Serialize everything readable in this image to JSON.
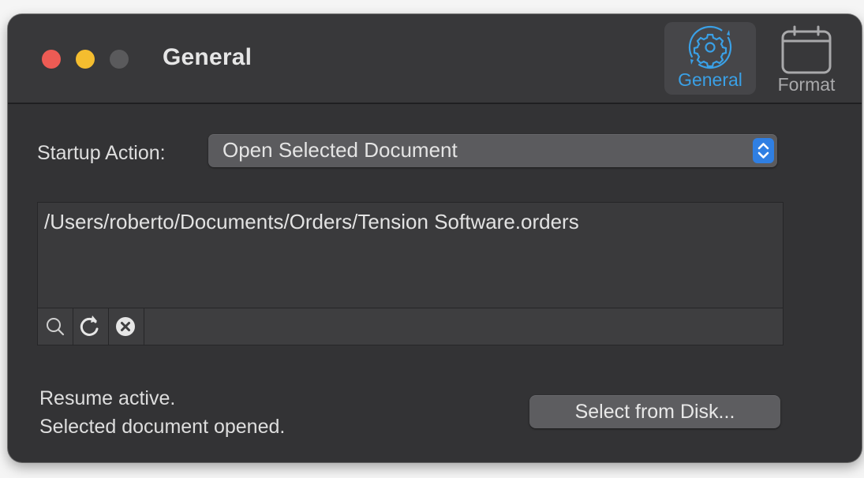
{
  "window": {
    "title": "General",
    "toolbar": {
      "general_label": "General",
      "format_label": "Format",
      "general_icon": "gear-icon",
      "format_icon": "calendar-icon"
    }
  },
  "startup": {
    "label": "Startup Action:",
    "selected": "Open Selected Document"
  },
  "document": {
    "path": "/Users/roberto/Documents/Orders/Tension Software.orders",
    "actions": [
      "search-icon",
      "refresh-icon",
      "clear-icon"
    ]
  },
  "status": {
    "line1": "Resume active.",
    "line2": "Selected document opened."
  },
  "select_button": "Select from Disk...",
  "colors": {
    "accent": "#3aa0e6",
    "stepper": "#2f7fe3",
    "close": "#ed5b54",
    "minimize": "#f4bd2f"
  }
}
